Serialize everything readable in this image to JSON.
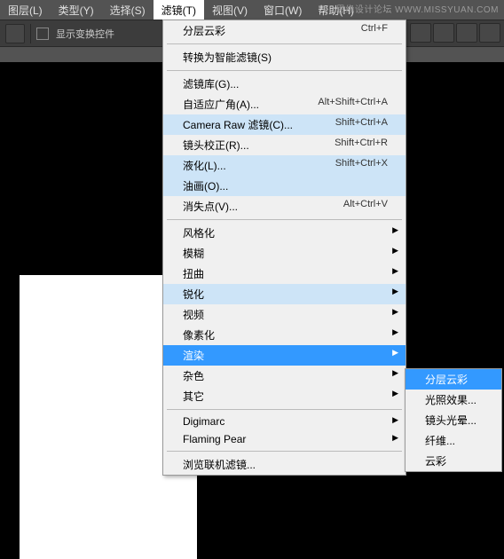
{
  "watermark_text": "思缘设计论坛 WWW.MISSYUAN.COM",
  "menubar": {
    "items": [
      "图层(L)",
      "类型(Y)",
      "选择(S)",
      "滤镜(T)",
      "视图(V)",
      "窗口(W)",
      "帮助(H)"
    ],
    "active_index": 3
  },
  "toolbar": {
    "checkbox_label": "显示变换控件"
  },
  "dropdown": {
    "items": [
      {
        "label": "分层云彩",
        "shortcut": "Ctrl+F",
        "type": "item"
      },
      {
        "type": "sep"
      },
      {
        "label": "转换为智能滤镜(S)",
        "type": "item"
      },
      {
        "type": "sep"
      },
      {
        "label": "滤镜库(G)...",
        "type": "item"
      },
      {
        "label": "自适应广角(A)...",
        "shortcut": "Alt+Shift+Ctrl+A",
        "type": "item"
      },
      {
        "label": "Camera Raw 滤镜(C)...",
        "shortcut": "Shift+Ctrl+A",
        "type": "item",
        "hl": "light"
      },
      {
        "label": "镜头校正(R)...",
        "shortcut": "Shift+Ctrl+R",
        "type": "item"
      },
      {
        "label": "液化(L)...",
        "shortcut": "Shift+Ctrl+X",
        "type": "item",
        "hl": "light"
      },
      {
        "label": "油画(O)...",
        "type": "item",
        "hl": "light"
      },
      {
        "label": "消失点(V)...",
        "shortcut": "Alt+Ctrl+V",
        "type": "item"
      },
      {
        "type": "sep"
      },
      {
        "label": "风格化",
        "type": "sub"
      },
      {
        "label": "模糊",
        "type": "sub"
      },
      {
        "label": "扭曲",
        "type": "sub"
      },
      {
        "label": "锐化",
        "type": "sub",
        "hl": "light"
      },
      {
        "label": "视频",
        "type": "sub"
      },
      {
        "label": "像素化",
        "type": "sub"
      },
      {
        "label": "渲染",
        "type": "sub",
        "hl": "blue"
      },
      {
        "label": "杂色",
        "type": "sub"
      },
      {
        "label": "其它",
        "type": "sub"
      },
      {
        "type": "sep"
      },
      {
        "label": "Digimarc",
        "type": "sub"
      },
      {
        "label": "Flaming Pear",
        "type": "sub"
      },
      {
        "type": "sep"
      },
      {
        "label": "浏览联机滤镜...",
        "type": "item"
      }
    ]
  },
  "submenu": {
    "items": [
      {
        "label": "分层云彩",
        "hl": "blue"
      },
      {
        "label": "光照效果..."
      },
      {
        "label": "镜头光晕..."
      },
      {
        "label": "纤维..."
      },
      {
        "label": "云彩"
      }
    ]
  }
}
